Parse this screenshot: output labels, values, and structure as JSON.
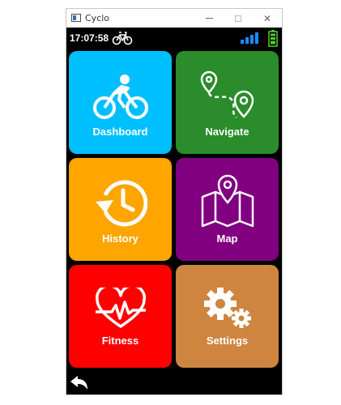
{
  "window": {
    "title": "Cyclo"
  },
  "status": {
    "time": "17:07:58",
    "signal_bars": 4,
    "battery_level": 1.0
  },
  "tiles": [
    {
      "label": "Dashboard",
      "icon": "bicycle-rider-icon",
      "color": "#00bfff"
    },
    {
      "label": "Navigate",
      "icon": "route-pins-icon",
      "color": "#2a8c2a"
    },
    {
      "label": "History",
      "icon": "history-clock-icon",
      "color": "#ffa500"
    },
    {
      "label": "Map",
      "icon": "map-pin-icon",
      "color": "#800080"
    },
    {
      "label": "Fitness",
      "icon": "heart-pulse-icon",
      "color": "#ff0000"
    },
    {
      "label": "Settings",
      "icon": "gears-icon",
      "color": "#cd853f"
    }
  ],
  "colors": {
    "signal": "#1a8cff",
    "battery": "#55cc33",
    "background": "#000000"
  }
}
